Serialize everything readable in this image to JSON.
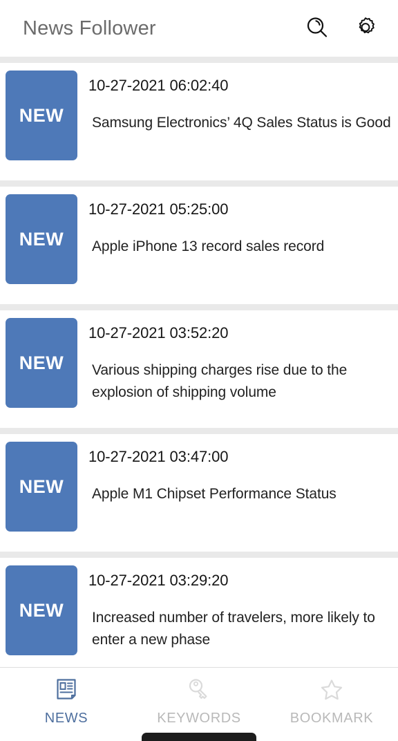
{
  "header": {
    "title": "News Follower",
    "search_icon": "search-icon",
    "settings_icon": "gear-icon"
  },
  "news": {
    "badge_label": "NEW",
    "items": [
      {
        "date": "10-27-2021 06:02:40",
        "title": "Samsung Electronics’ 4Q Sales Status is Good",
        "badge": "NEW"
      },
      {
        "date": "10-27-2021 05:25:00",
        "title": "Apple iPhone 13 record sales record",
        "badge": "NEW"
      },
      {
        "date": "10-27-2021 03:52:20",
        "title": "Various shipping charges rise due to the explosion of shipping volume",
        "badge": "NEW"
      },
      {
        "date": "10-27-2021 03:47:00",
        "title": "Apple M1 Chipset Performance Status",
        "badge": "NEW"
      },
      {
        "date": "10-27-2021 03:29:20",
        "title": "Increased number of travelers, more likely to enter a new phase",
        "badge": "NEW"
      }
    ]
  },
  "bottom_nav": {
    "items": [
      {
        "label": "NEWS",
        "icon": "newspaper-icon",
        "active": true
      },
      {
        "label": "KEYWORDS",
        "icon": "key-icon",
        "active": false
      },
      {
        "label": "BOOKMARK",
        "icon": "star-icon",
        "active": false
      }
    ]
  },
  "colors": {
    "badge_blue": "#4e79b8",
    "active_nav": "#4e6f9e",
    "inactive_nav": "#b9b9b9",
    "page_background": "#e9e9e9",
    "card_background": "#ffffff",
    "title_text": "#6b6b6b"
  }
}
